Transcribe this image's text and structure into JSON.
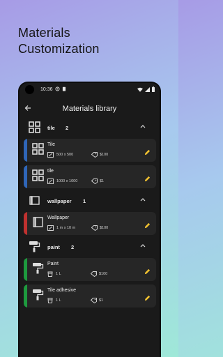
{
  "headline": {
    "line1": "Materials",
    "line2": "Customization"
  },
  "status_bar": {
    "time": "10:36"
  },
  "app_bar": {
    "title": "Materials library",
    "back_icon": "arrow-back-icon"
  },
  "colors": {
    "tile": "#2f66b8",
    "wallpaper": "#c0312f",
    "paint": "#1e9a3e",
    "edit": "#f2c230"
  },
  "groups": [
    {
      "name": "tile",
      "count": "2",
      "icon": "grid-icon",
      "items": [
        {
          "name": "Tile",
          "qty": "500 x 500",
          "price": "$100"
        },
        {
          "name": "tile",
          "qty": "1000 x 1000",
          "price": "$1"
        }
      ]
    },
    {
      "name": "wallpaper",
      "count": "1",
      "icon": "wallpaper-icon",
      "items": [
        {
          "name": "Wallpaper",
          "qty": "1 m x 10 m",
          "price": "$100"
        }
      ]
    },
    {
      "name": "paint",
      "count": "2",
      "icon": "paint-roller-icon",
      "items": [
        {
          "name": "Paint",
          "qty": "1 L",
          "price": "$100"
        },
        {
          "name": "Tile adhesive",
          "qty": "1 L",
          "price": "$1"
        }
      ]
    }
  ]
}
